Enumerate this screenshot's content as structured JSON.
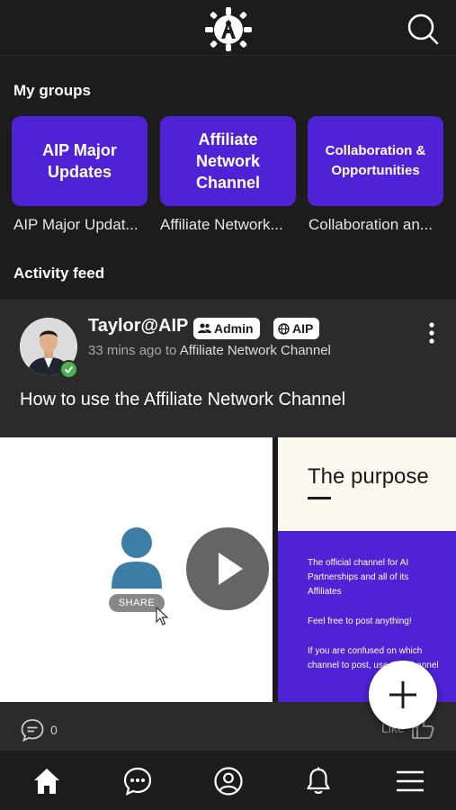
{
  "header": {
    "logo_icon": "aip-logo-icon",
    "search_icon": "search-icon"
  },
  "my_groups": {
    "title": "My groups",
    "groups": [
      {
        "card_title": "AIP Major Updates",
        "caption": "AIP Major Updat..."
      },
      {
        "card_title": "Affiliate Network Channel",
        "caption": "Affiliate Network..."
      },
      {
        "card_title": "Collaboration & Opportunities",
        "caption": "Collaboration an..."
      }
    ]
  },
  "activity_feed": {
    "title": "Activity feed",
    "post": {
      "author": "Taylor@AIP",
      "badges": [
        "Admin",
        "AIP"
      ],
      "time": "33 mins ago to",
      "channel": "Affiliate Network Channel",
      "text": "How to use the Affiliate Network Channel",
      "media": {
        "share_label": "SHARE",
        "slide_title": "The purpose",
        "slide_paragraphs": [
          "The official channel for AI Partnerships and all of its Affiliates",
          "Feel free to post anything!",
          "If you are confused on which channel to post, use this channel"
        ]
      },
      "comment_count": "0",
      "like_label": "Like"
    }
  },
  "bottom_nav": [
    "home-icon",
    "chat-icon",
    "profile-icon",
    "bell-icon",
    "menu-icon"
  ],
  "colors": {
    "background": "#1c1c1c",
    "card_purple": "#4f22d6",
    "post_background": "#2b2b2b",
    "verified_green": "#4caf50"
  }
}
